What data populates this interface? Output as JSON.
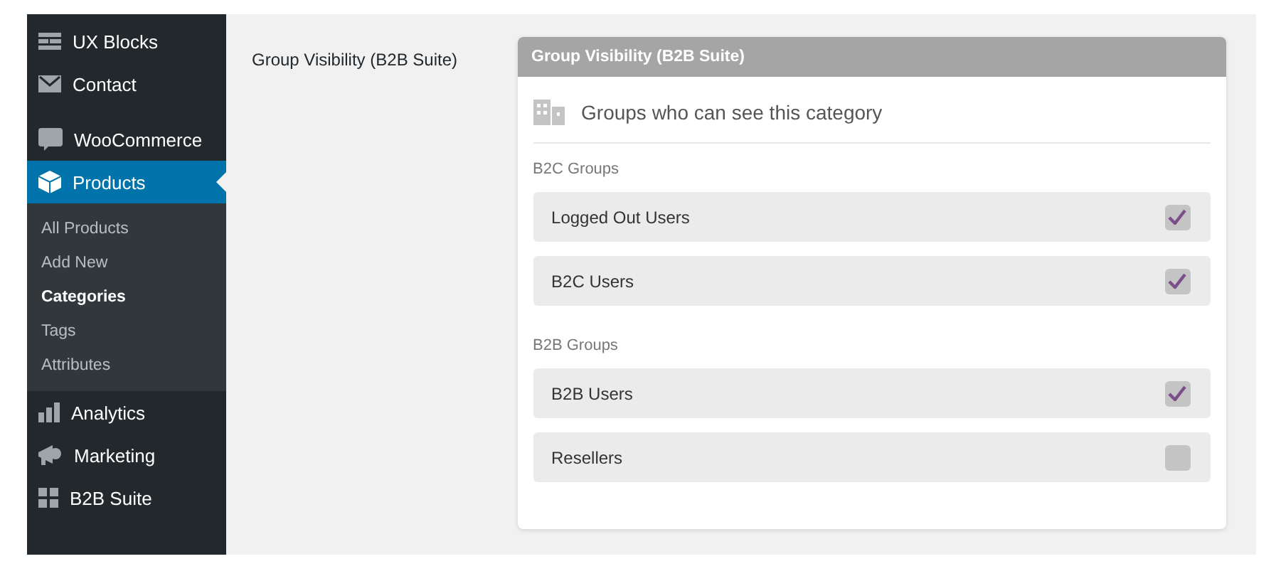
{
  "sidebar": {
    "items": [
      {
        "label": "UX Blocks",
        "selected": false
      },
      {
        "label": "Contact",
        "selected": false
      },
      {
        "label": "WooCommerce",
        "selected": false
      },
      {
        "label": "Products",
        "selected": true,
        "children": [
          {
            "label": "All Products",
            "selected": false
          },
          {
            "label": "Add New",
            "selected": false
          },
          {
            "label": "Categories",
            "selected": true
          },
          {
            "label": "Tags",
            "selected": false
          },
          {
            "label": "Attributes",
            "selected": false
          }
        ]
      },
      {
        "label": "Analytics",
        "selected": false
      },
      {
        "label": "Marketing",
        "selected": false
      },
      {
        "label": "B2B Suite",
        "selected": false
      }
    ]
  },
  "field_label": "Group Visibility (B2B Suite)",
  "panel": {
    "title": "Group Visibility (B2B Suite)",
    "heading": "Groups who can see this category",
    "sections": [
      {
        "title": "B2C Groups",
        "options": [
          {
            "label": "Logged Out Users",
            "checked": true
          },
          {
            "label": "B2C Users",
            "checked": true
          }
        ]
      },
      {
        "title": "B2B Groups",
        "options": [
          {
            "label": "B2B Users",
            "checked": true
          },
          {
            "label": "Resellers",
            "checked": false
          }
        ]
      }
    ]
  }
}
